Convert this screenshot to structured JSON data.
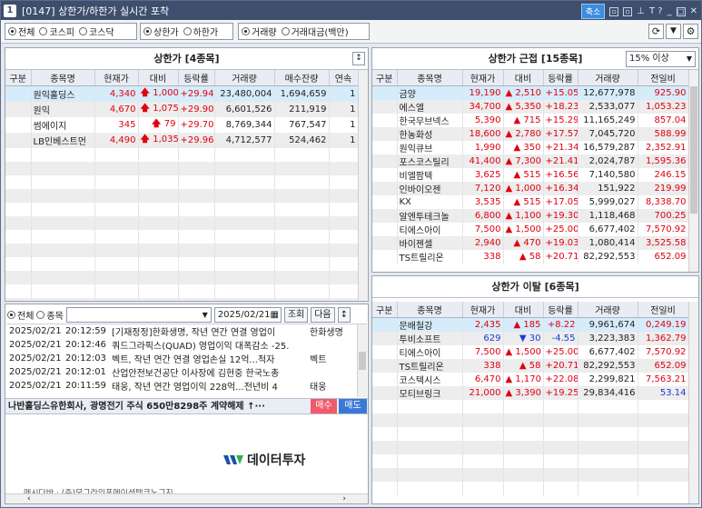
{
  "window": {
    "number": "1",
    "title": "[0147] 상한가/하한가 실시간 포착",
    "shrink_label": "축소",
    "help_label": "T ?"
  },
  "options": {
    "market": {
      "all": "전체",
      "kospi": "코스피",
      "kosdaq": "코스닥",
      "selected": "all"
    },
    "limit": {
      "upper": "상한가",
      "lower": "하한가",
      "selected": "upper"
    },
    "criteria": {
      "volume": "거래량",
      "amount": "거래대금(백만)",
      "selected": "volume"
    },
    "refresh_icon": "refresh-icon",
    "dropdown_icon": "triangle-down-icon",
    "settings_icon": "gear-icon"
  },
  "upper_panel": {
    "title": "상한가 [4종목]",
    "columns": [
      "구분",
      "종목명",
      "현재가",
      "대비",
      "등락률",
      "거래량",
      "매수잔량",
      "연속"
    ],
    "rows": [
      {
        "type": "",
        "name": "원익홀딩스",
        "price": "4,340",
        "arrow": "up",
        "change": "1,000",
        "rate": "+29.94",
        "volume": "23,480,004",
        "bid": "1,694,659",
        "streak": "1",
        "selected": true
      },
      {
        "type": "",
        "name": "원익",
        "price": "4,670",
        "arrow": "up",
        "change": "1,075",
        "rate": "+29.90",
        "volume": "6,601,526",
        "bid": "211,919",
        "streak": "1"
      },
      {
        "type": "",
        "name": "썸에이지",
        "price": "345",
        "arrow": "up",
        "change": "79",
        "rate": "+29.70",
        "volume": "8,769,344",
        "bid": "767,547",
        "streak": "1"
      },
      {
        "type": "",
        "name": "LB인베스트먼",
        "price": "4,490",
        "arrow": "up",
        "change": "1,035",
        "rate": "+29.96",
        "volume": "4,712,577",
        "bid": "524,462",
        "streak": "1"
      }
    ]
  },
  "near_panel": {
    "title": "상한가 근접 [15종목]",
    "filter": "15% 이상",
    "columns": [
      "구분",
      "종목명",
      "현재가",
      "대비",
      "등락률",
      "거래량",
      "전일비"
    ],
    "rows": [
      {
        "name": "금양",
        "price": "19,190",
        "change": "2,510",
        "rate": "+15.05",
        "volume": "12,677,978",
        "prev": "925.90",
        "selected": true
      },
      {
        "name": "에스엘",
        "price": "34,700",
        "change": "5,350",
        "rate": "+18.23",
        "volume": "2,533,077",
        "prev": "1,053.23"
      },
      {
        "name": "한국무브넥스",
        "price": "5,390",
        "change": "715",
        "rate": "+15.29",
        "volume": "11,165,249",
        "prev": "857.04"
      },
      {
        "name": "한농화성",
        "price": "18,600",
        "change": "2,780",
        "rate": "+17.57",
        "volume": "7,045,720",
        "prev": "588.99"
      },
      {
        "name": "원익큐브",
        "price": "1,990",
        "change": "350",
        "rate": "+21.34",
        "volume": "16,579,287",
        "prev": "2,352.91"
      },
      {
        "name": "포스코스틸리",
        "price": "41,400",
        "change": "7,300",
        "rate": "+21.41",
        "volume": "2,024,787",
        "prev": "1,595.36"
      },
      {
        "name": "비엘팜텍",
        "price": "3,625",
        "change": "515",
        "rate": "+16.56",
        "volume": "7,140,580",
        "prev": "246.15"
      },
      {
        "name": "인바이오젠",
        "price": "7,120",
        "change": "1,000",
        "rate": "+16.34",
        "volume": "151,922",
        "prev": "219.99"
      },
      {
        "name": "KX",
        "price": "3,535",
        "change": "515",
        "rate": "+17.05",
        "volume": "5,999,027",
        "prev": "8,338.70"
      },
      {
        "name": "알엔투테크놀",
        "price": "6,800",
        "change": "1,100",
        "rate": "+19.30",
        "volume": "1,118,468",
        "prev": "700.25"
      },
      {
        "name": "티에스아이",
        "price": "7,500",
        "change": "1,500",
        "rate": "+25.00",
        "volume": "6,677,402",
        "prev": "7,570.92"
      },
      {
        "name": "바이젠셀",
        "price": "2,940",
        "change": "470",
        "rate": "+19.03",
        "volume": "1,080,414",
        "prev": "3,525.58"
      },
      {
        "name": "TS트릴리온",
        "price": "338",
        "change": "58",
        "rate": "+20.71",
        "volume": "82,292,553",
        "prev": "652.09"
      }
    ]
  },
  "break_panel": {
    "title": "상한가 이탈 [6종목]",
    "columns": [
      "구분",
      "종목명",
      "현재가",
      "대비",
      "등락률",
      "거래량",
      "전일비"
    ],
    "rows": [
      {
        "name": "문배철강",
        "price": "2,435",
        "dir": "up",
        "change": "185",
        "rate": "+8.22",
        "volume": "9,961,674",
        "prev": "0,249.19",
        "selected": true
      },
      {
        "name": "투비소프트",
        "price": "629",
        "dir": "down",
        "change": "30",
        "rate": "-4.55",
        "volume": "3,223,383",
        "prev": "1,362.79"
      },
      {
        "name": "티에스아이",
        "price": "7,500",
        "dir": "up",
        "change": "1,500",
        "rate": "+25.00",
        "volume": "6,677,402",
        "prev": "7,570.92"
      },
      {
        "name": "TS트릴리온",
        "price": "338",
        "dir": "up",
        "change": "58",
        "rate": "+20.71",
        "volume": "82,292,553",
        "prev": "652.09"
      },
      {
        "name": "코스텍시스",
        "price": "6,470",
        "dir": "up",
        "change": "1,170",
        "rate": "+22.08",
        "volume": "2,299,821",
        "prev": "7,563.21"
      },
      {
        "name": "모티브링크",
        "price": "21,000",
        "dir": "up",
        "change": "3,390",
        "rate": "+19.25",
        "volume": "29,834,416",
        "prev": "53.14"
      }
    ]
  },
  "news": {
    "scope": {
      "all": "전체",
      "stock": "종목",
      "selected": "all"
    },
    "date": "2025/02/21",
    "query_label": "조회",
    "next_label": "다음",
    "rows": [
      {
        "date": "2025/02/21",
        "time": "20:12:59",
        "title": "[기재정정]한화생명, 작년 연간 연결 영업이",
        "stock": "한화생명"
      },
      {
        "date": "2025/02/21",
        "time": "20:12:46",
        "title": "쿼드그라픽스(QUAD) 영업이익 대폭감소 -25.",
        "stock": ""
      },
      {
        "date": "2025/02/21",
        "time": "20:12:03",
        "title": "벡트, 작년 연간 연결 영업손실 12억...적자",
        "stock": "벡트"
      },
      {
        "date": "2025/02/21",
        "time": "20:12:01",
        "title": "산업안전보건공단 이사장에 김현중 한국노총",
        "stock": ""
      },
      {
        "date": "2025/02/21",
        "time": "20:11:59",
        "title": "태웅, 작년 연간 영업이익 228억...전년비 4",
        "stock": "태웅"
      }
    ],
    "headline": "나반홀딩스유한회사, 광명전기 주식 650만8298주 계약해제 ↑···",
    "buy_label": "매수",
    "sell_label": "매도",
    "logo_text": "데이터투자",
    "bottom_text": "메시다바 · (주)모그라인포메이션텍크노그지"
  }
}
